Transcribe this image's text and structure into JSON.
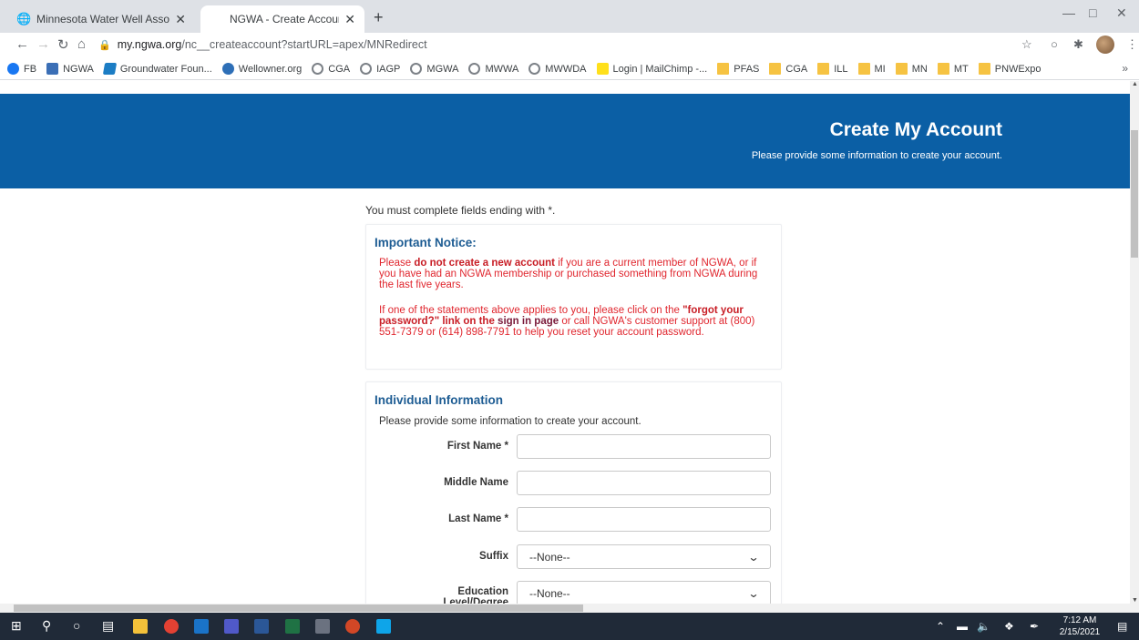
{
  "browser": {
    "tabs": [
      {
        "title": "Minnesota Water Well Associatio",
        "active": false
      },
      {
        "title": "NGWA - Create Account",
        "active": true
      }
    ],
    "url_host": "my.ngwa.org",
    "url_path": "/nc__createaccount?startURL=apex/MNRedirect",
    "bookmarks": [
      {
        "label": "FB",
        "icon": "facebook-icon"
      },
      {
        "label": "NGWA",
        "icon": "ngwa-icon"
      },
      {
        "label": "Groundwater Foun...",
        "icon": "groundwater-icon"
      },
      {
        "label": "Wellowner.org",
        "icon": "wellowner-icon"
      },
      {
        "label": "CGA",
        "icon": "globe-icon"
      },
      {
        "label": "IAGP",
        "icon": "globe-icon"
      },
      {
        "label": "MGWA",
        "icon": "globe-icon"
      },
      {
        "label": "MWWA",
        "icon": "globe-icon"
      },
      {
        "label": "MWWDA",
        "icon": "globe-icon"
      },
      {
        "label": "Login | MailChimp -...",
        "icon": "mailchimp-icon"
      },
      {
        "label": "PFAS",
        "icon": "folder-icon"
      },
      {
        "label": "CGA",
        "icon": "folder-icon"
      },
      {
        "label": "ILL",
        "icon": "folder-icon"
      },
      {
        "label": "MI",
        "icon": "folder-icon"
      },
      {
        "label": "MN",
        "icon": "folder-icon"
      },
      {
        "label": "MT",
        "icon": "folder-icon"
      },
      {
        "label": "PNWExpo",
        "icon": "folder-icon"
      }
    ],
    "bookmarks_overflow": "»"
  },
  "hero": {
    "title": "Create My Account",
    "subtitle": "Please provide some information to create your account."
  },
  "required_note": "You must complete fields ending with *.",
  "notice": {
    "heading": "Important Notice:",
    "p1_a": "Please ",
    "p1_b": "do not create a new account",
    "p1_c": " if you are a current member of NGWA, or if you have had an NGWA membership or purchased something from NGWA during the last five years.",
    "p2_a": "If one of the statements above applies to you, please click on the ",
    "p2_b": "\"forgot your password?\" link on the",
    "p2_c": " sign in page",
    "p2_d": " or call NGWA's customer support at (800) 551-7379 or (614) 898-7791 to help you reset your account password."
  },
  "individual": {
    "heading": "Individual Information",
    "subtext": "Please provide some information to create your account.",
    "fields": [
      {
        "label": "First Name *",
        "value": ""
      },
      {
        "label": "Middle Name",
        "value": ""
      },
      {
        "label": "Last Name *",
        "value": ""
      },
      {
        "label": "Suffix",
        "value": "--None--"
      },
      {
        "label": "Education Level/Degree",
        "value": "--None--"
      }
    ]
  },
  "taskbar": {
    "time": "7:12 AM",
    "date": "2/15/2021"
  },
  "colors": {
    "hero_bg": "#0b5fa5",
    "heading_blue": "#1d5c93",
    "notice_red": "#e0262e"
  }
}
